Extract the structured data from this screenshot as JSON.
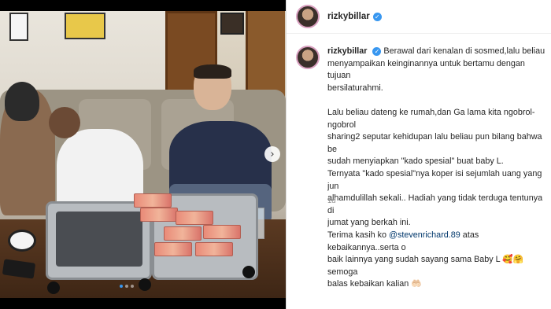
{
  "post": {
    "username": "rizkybillar",
    "caption_line1": "Berawal dari kenalan di sosmed,lalu beliau",
    "caption_lines": "menyampaikan keinginannya untuk bertamu dengan tujuan\nbersilaturahmi.\n\nLalu beliau dateng ke rumah,dan Ga lama kita ngobrol-ngobrol\nsharing2 seputar kehidupan lalu beliau pun bilang bahwa be\nsudah menyiapkan \"kado spesial\" buat baby L.\nTernyata \"kado spesial\"nya koper isi sejumlah uang yang jun\nalhamdulillah sekali.. Hadiah yang tidak terduga tentunya di\njumat yang berkah ini.\nTerima kasih ko ",
    "mention": "@stevenrichard.89",
    "caption_after_mention": " atas kebaikannya..serta o\nbaik lainnya yang sudah sayang sama Baby L 🥰🤗 semoga\nbalas kebaikan kalian 🤲🏻",
    "time": "1d"
  },
  "photo": {
    "next_arrow": "›",
    "slide_count": 3,
    "active_slide": 0
  },
  "icons": {
    "verified": "verified-badge-icon",
    "next": "chevron-right-icon",
    "avatar": "profile-avatar"
  }
}
